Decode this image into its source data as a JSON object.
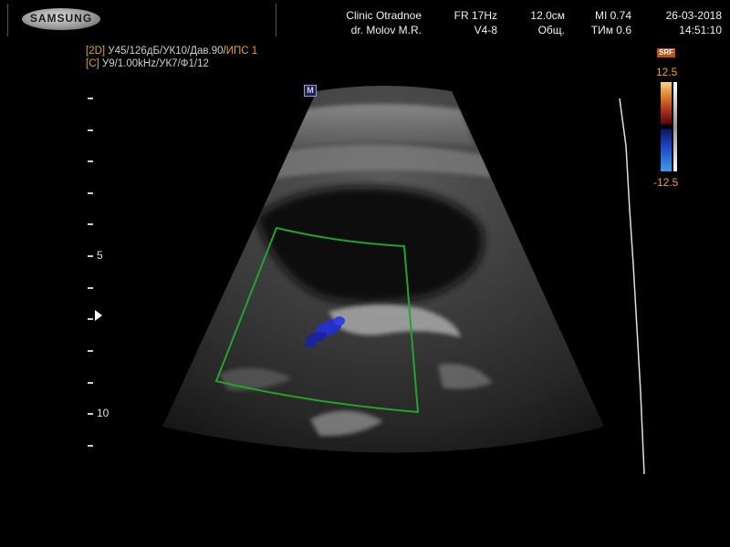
{
  "brand": {
    "logo_text": "SAMSUNG"
  },
  "header": {
    "clinic": "Clinic  Otradnoe",
    "doctor": "dr. Molov M.R.",
    "frame_rate": "FR 17Hz",
    "probe": "V4-8",
    "depth": "12.0см",
    "preset": "Общ.",
    "mi": "MI  0.74",
    "tim": "TИм 0.6",
    "date": "26-03-2018",
    "time": "14:51:10"
  },
  "params": {
    "line1_tag": "[2D]",
    "line1_text": " У45/126дБ/УК10/Дав.90/",
    "line1_tail": "ИПС 1",
    "line2_tag": "[C]",
    "line2_text": " У9/1.00kHz/УК7/Ф1/12"
  },
  "depth_scale": {
    "labels": [
      "5",
      "10"
    ],
    "focus_marker_icon": "focus-arrow-icon"
  },
  "markers": {
    "orientation_badge": "M"
  },
  "color_scale": {
    "max": "12.5",
    "min": "-12.5",
    "badge": "SRF",
    "colors": {
      "positive": "#e18c2a",
      "negative": "#1d44c8"
    }
  },
  "colors": {
    "roi_box": "#1fa52a",
    "doppler_flow": "#2430c8"
  }
}
